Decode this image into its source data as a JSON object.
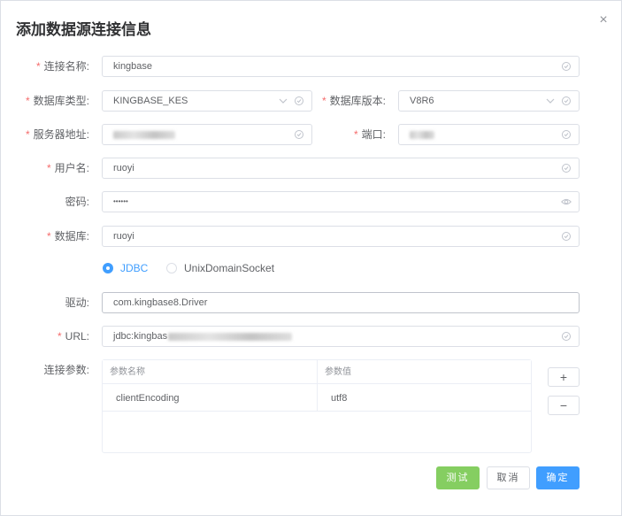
{
  "dialog": {
    "title": "添加数据源连接信息",
    "close_icon": "×"
  },
  "form": {
    "name": {
      "label": "连接名称:",
      "value": "kingbase"
    },
    "db_type": {
      "label": "数据库类型:",
      "value": "KINGBASE_KES"
    },
    "db_version": {
      "label": "数据库版本:",
      "value": "V8R6"
    },
    "host": {
      "label": "服务器地址:",
      "value": ""
    },
    "port": {
      "label": "端口:",
      "value": ""
    },
    "username": {
      "label": "用户名:",
      "value": "ruoyi"
    },
    "password": {
      "label": "密码:",
      "value": "••••••"
    },
    "database": {
      "label": "数据库:",
      "value": "ruoyi"
    },
    "connection_mode": {
      "options": [
        "JDBC",
        "UnixDomainSocket"
      ],
      "selected": "JDBC"
    },
    "driver": {
      "label": "驱动:",
      "value": "com.kingbase8.Driver"
    },
    "url": {
      "label": "URL:",
      "value": "jdbc:kingbas"
    },
    "params": {
      "label": "连接参数:",
      "columns": [
        "参数名称",
        "参数值"
      ],
      "rows": [
        {
          "name": "clientEncoding",
          "value": "utf8"
        }
      ],
      "add_label": "+",
      "remove_label": "−"
    }
  },
  "footer": {
    "test_label": "测试",
    "cancel_label": "取消",
    "ok_label": "确定"
  },
  "colors": {
    "primary": "#409eff",
    "success": "#85ce61",
    "required": "#f56c6c"
  }
}
